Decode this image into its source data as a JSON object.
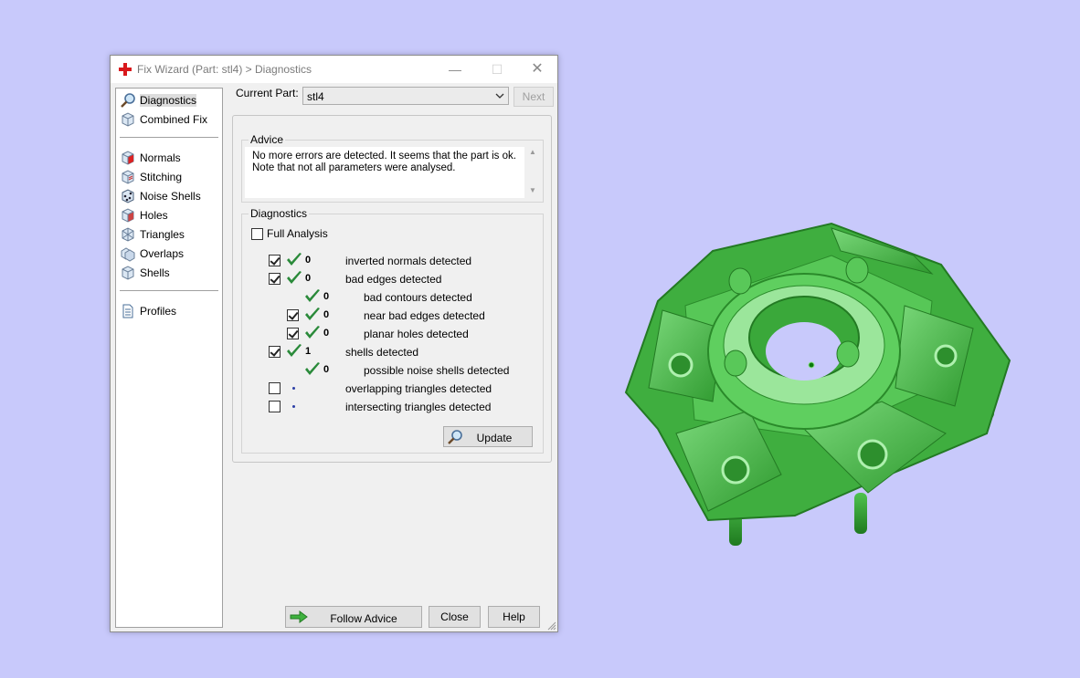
{
  "window": {
    "title": "Fix Wizard (Part: stl4) > Diagnostics",
    "minimize": "—",
    "maximize": "☐",
    "close": "✕"
  },
  "sidebar": {
    "items": [
      {
        "label": "Diagnostics",
        "icon": "magnifier-icon"
      },
      {
        "label": "Combined Fix",
        "icon": "cube-icon"
      },
      {
        "label": "Normals",
        "icon": "normals-cube-icon"
      },
      {
        "label": "Stitching",
        "icon": "stitching-cube-icon"
      },
      {
        "label": "Noise Shells",
        "icon": "noise-shells-icon"
      },
      {
        "label": "Holes",
        "icon": "holes-cube-icon"
      },
      {
        "label": "Triangles",
        "icon": "triangles-icon"
      },
      {
        "label": "Overlaps",
        "icon": "overlaps-icon"
      },
      {
        "label": "Shells",
        "icon": "shells-icon"
      },
      {
        "label": "Profiles",
        "icon": "document-icon"
      }
    ]
  },
  "current_part": {
    "label": "Current Part:",
    "value": "stl4",
    "next_label": "Next"
  },
  "advice": {
    "title": "Advice",
    "line1": "No more errors are detected. It seems that the part is ok.",
    "line2": "Note that not all parameters were analysed."
  },
  "diagnostics": {
    "title": "Diagnostics",
    "full_analysis_label": "Full Analysis",
    "full_analysis_checked": false,
    "rows": [
      {
        "count": "0",
        "label": "inverted normals detected",
        "level": 0,
        "checkbox": true,
        "checked": true,
        "status": "ok"
      },
      {
        "count": "0",
        "label": "bad edges detected",
        "level": 0,
        "checkbox": true,
        "checked": true,
        "status": "ok"
      },
      {
        "count": "0",
        "label": "bad contours detected",
        "level": 1,
        "checkbox": false,
        "checked": false,
        "status": "ok"
      },
      {
        "count": "0",
        "label": "near bad edges detected",
        "level": 1,
        "checkbox": true,
        "checked": true,
        "status": "ok"
      },
      {
        "count": "0",
        "label": "planar holes detected",
        "level": 1,
        "checkbox": true,
        "checked": true,
        "status": "ok"
      },
      {
        "count": "1",
        "label": "shells detected",
        "level": 0,
        "checkbox": true,
        "checked": true,
        "status": "ok"
      },
      {
        "count": "0",
        "label": "possible noise shells detected",
        "level": 1,
        "checkbox": false,
        "checked": false,
        "status": "ok"
      },
      {
        "count": "",
        "label": "overlapping triangles detected",
        "level": 0,
        "checkbox": true,
        "checked": false,
        "status": "pending"
      },
      {
        "count": "",
        "label": "intersecting triangles detected",
        "level": 0,
        "checkbox": true,
        "checked": false,
        "status": "pending"
      }
    ],
    "update_label": "Update"
  },
  "buttons": {
    "follow_advice": "Follow Advice",
    "close": "Close",
    "help": "Help"
  },
  "colors": {
    "background": "#c8c9fb",
    "model_green": "#4fc34f",
    "check_green": "#2a8a3a"
  }
}
